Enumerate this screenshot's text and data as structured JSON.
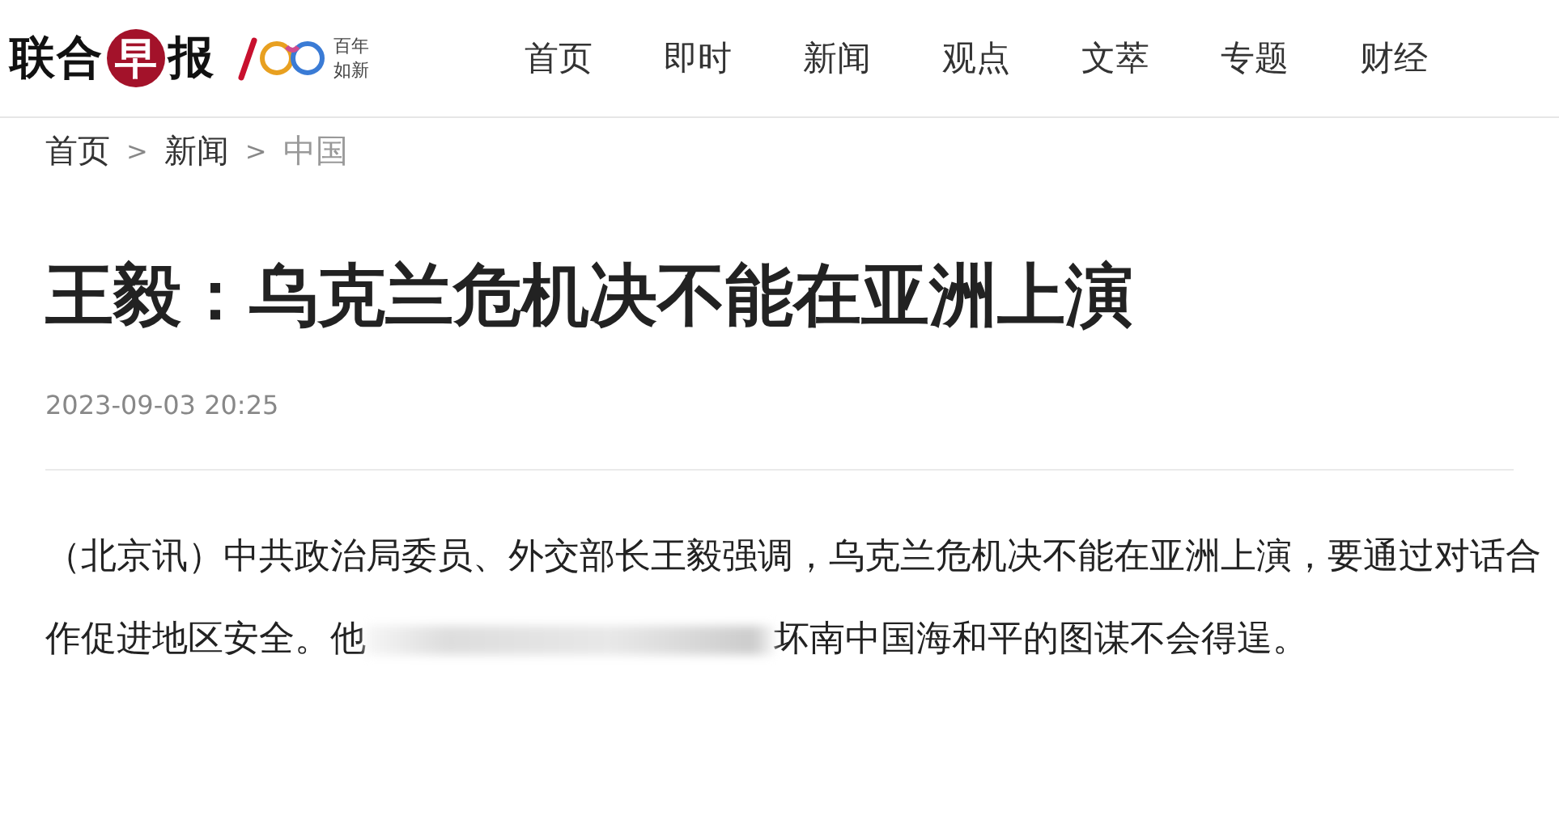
{
  "logo": {
    "before": "联合",
    "badge": "早",
    "after": "报",
    "tagline": [
      "百年",
      "如新"
    ]
  },
  "nav": [
    {
      "label": "首页"
    },
    {
      "label": "即时"
    },
    {
      "label": "新闻"
    },
    {
      "label": "观点"
    },
    {
      "label": "文萃"
    },
    {
      "label": "专题"
    },
    {
      "label": "财经"
    }
  ],
  "breadcrumb": {
    "separator": ">",
    "items": [
      {
        "label": "首页",
        "current": false
      },
      {
        "label": "新闻",
        "current": false
      },
      {
        "label": "中国",
        "current": true
      }
    ]
  },
  "article": {
    "title": "王毅：乌克兰危机决不能在亚洲上演",
    "date": "2023-09-03 20:25",
    "body": [
      {
        "kind": "text",
        "text": "（北京讯）中共政治局委员、外交部长王毅强调，乌克兰危机决不能在亚洲上演，要通过对话合作促进地区安全。他"
      },
      {
        "kind": "blur"
      },
      {
        "kind": "text",
        "text": "坏南中国海和平的图谋不会得逞。"
      }
    ]
  }
}
